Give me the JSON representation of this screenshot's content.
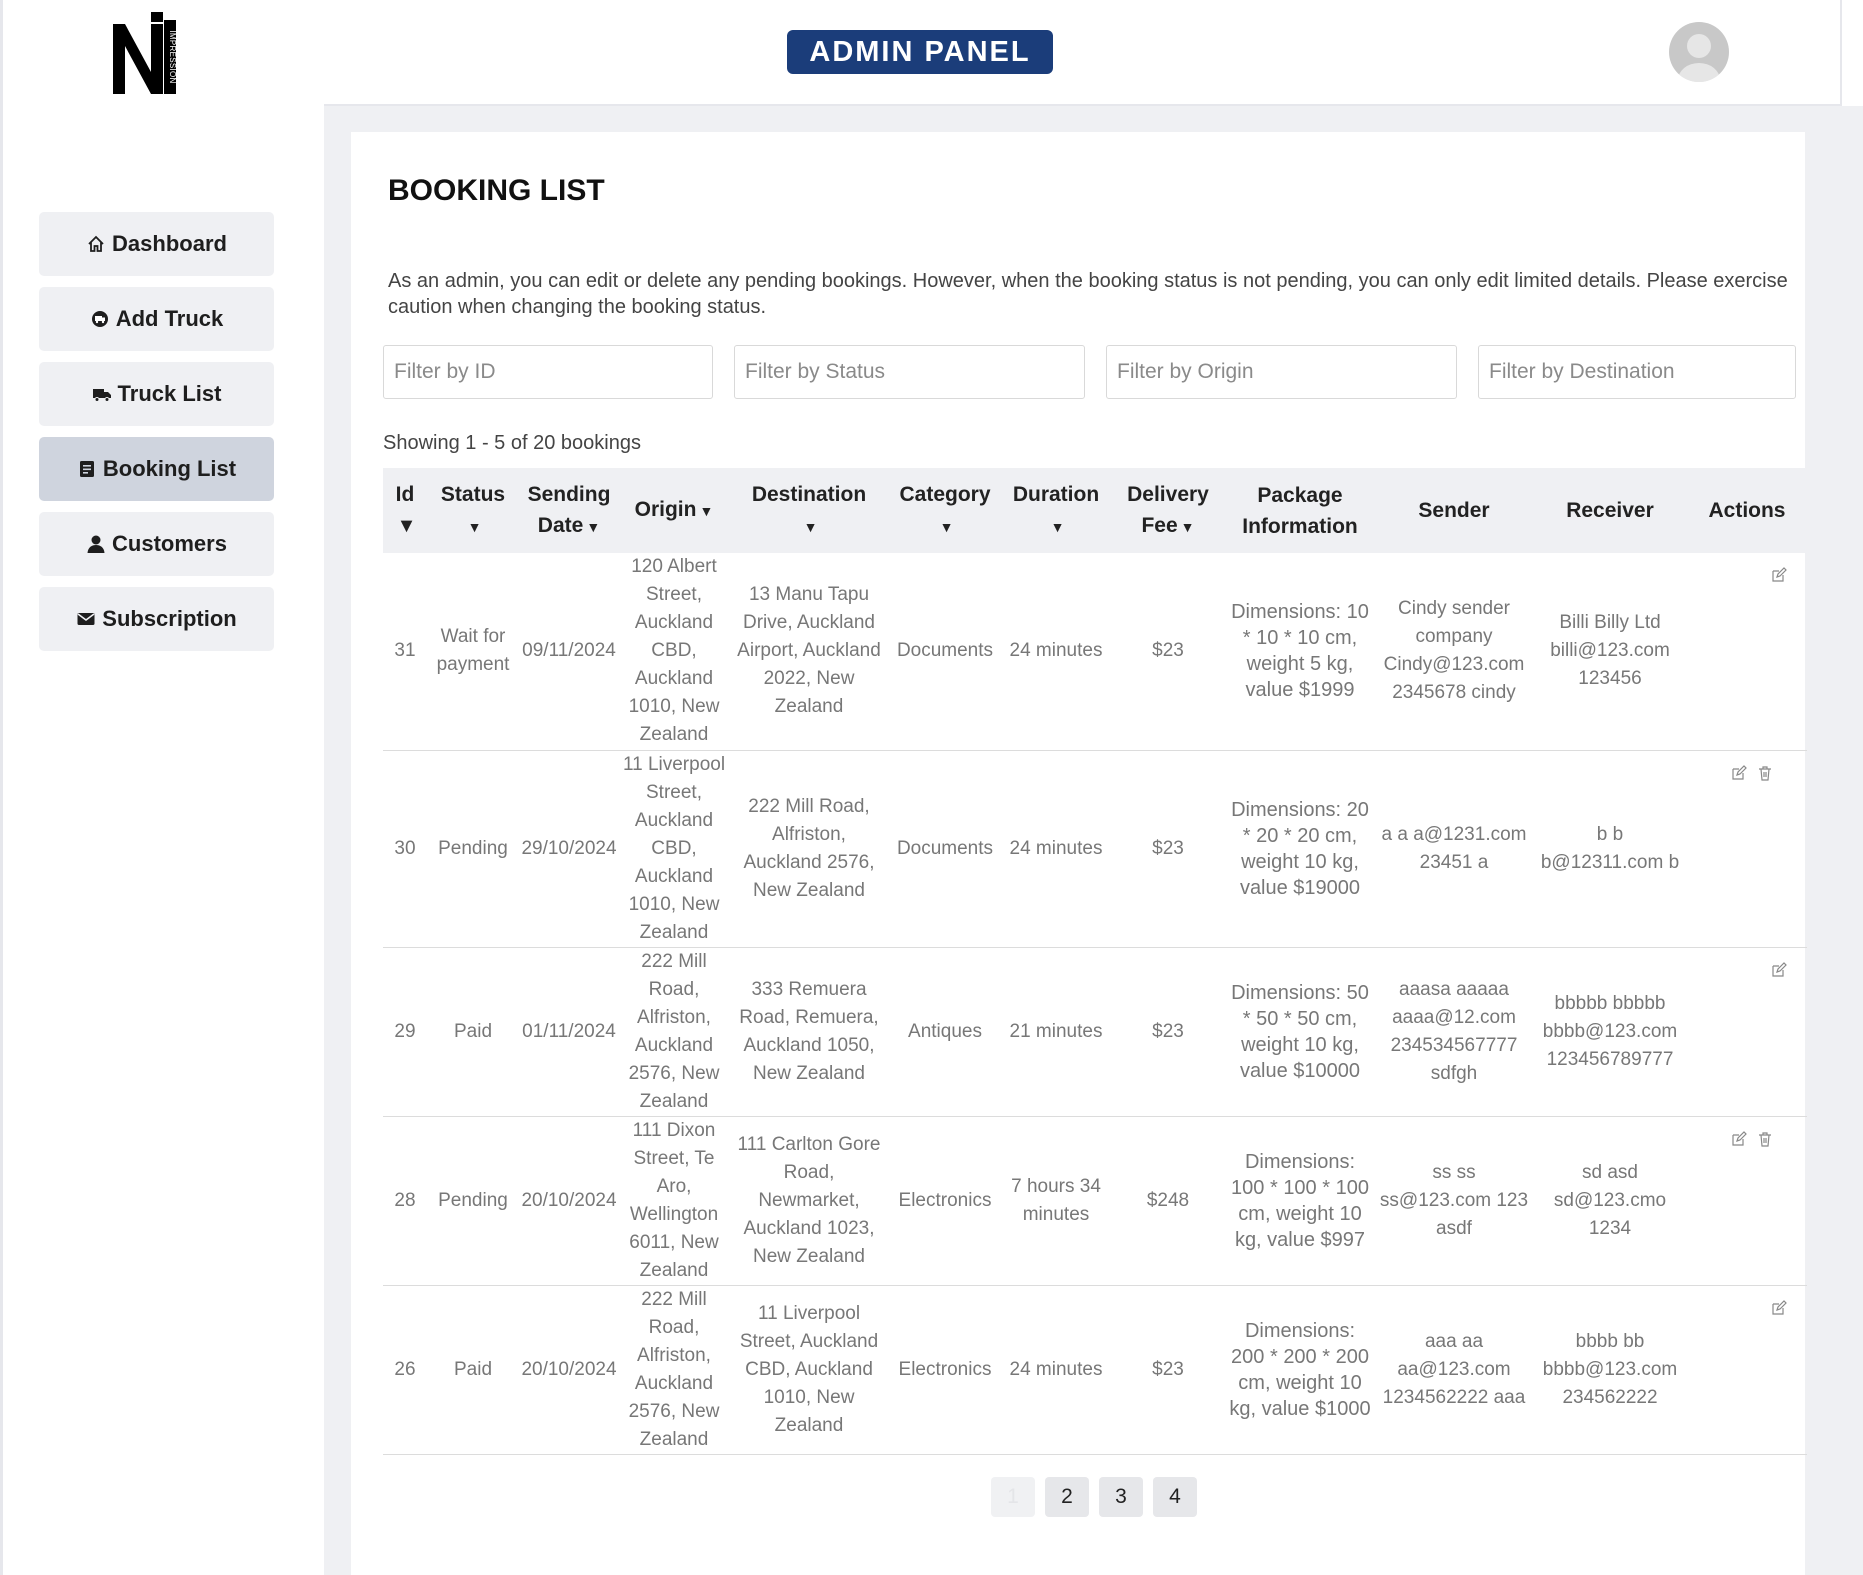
{
  "logo": {
    "letter": "N",
    "text": "IMPRESSION"
  },
  "header": {
    "badge": "ADMIN PANEL",
    "avatar_icon": "user-avatar-icon"
  },
  "sidebar": {
    "items": [
      {
        "label": "Dashboard",
        "icon": "home-icon"
      },
      {
        "label": "Add Truck",
        "icon": "truck-add-icon"
      },
      {
        "label": "Truck List",
        "icon": "truck-icon"
      },
      {
        "label": "Booking List",
        "icon": "book-icon",
        "active": true
      },
      {
        "label": "Customers",
        "icon": "user-icon"
      },
      {
        "label": "Subscription",
        "icon": "envelope-icon"
      }
    ]
  },
  "page": {
    "title": "BOOKING LIST",
    "notice": "As an admin, you can edit or delete any pending bookings. However, when the booking status is not pending, you can only edit limited details. Please exercise caution when changing the booking status.",
    "showing": "Showing 1 - 5 of 20 bookings"
  },
  "filters": {
    "id_placeholder": "Filter by ID",
    "status_placeholder": "Filter by Status",
    "origin_placeholder": "Filter by Origin",
    "destination_placeholder": "Filter by Destination"
  },
  "table": {
    "headers": {
      "id": "Id",
      "status": "Status",
      "sending_date": "Sending Date",
      "origin": "Origin",
      "destination": "Destination",
      "category": "Category",
      "duration": "Duration",
      "delivery_fee": "Delivery Fee",
      "package": "Package Information",
      "sender": "Sender",
      "receiver": "Receiver",
      "actions": "Actions"
    },
    "rows": [
      {
        "id": "31",
        "status": "Wait for payment",
        "date": "09/11/2024",
        "origin": "120 Albert Street, Auckland CBD, Auckland 1010, New Zealand",
        "destination": "13 Manu Tapu Drive, Auckland Airport, Auckland 2022, New Zealand",
        "category": "Documents",
        "duration": "24 minutes",
        "fee": "$23",
        "package": "Dimensions: 10 * 10 * 10 cm, weight 5 kg, value $1999",
        "sender": "Cindy sender company Cindy@123.com 2345678 cindy",
        "receiver": "Billi Billy Ltd billi@123.com 123456",
        "deletable": false
      },
      {
        "id": "30",
        "status": "Pending",
        "date": "29/10/2024",
        "origin": "11 Liverpool Street, Auckland CBD, Auckland 1010, New Zealand",
        "destination": "222 Mill Road, Alfriston, Auckland 2576, New Zealand",
        "category": "Documents",
        "duration": "24 minutes",
        "fee": "$23",
        "package": "Dimensions: 20 * 20 * 20 cm, weight 10 kg, value $19000",
        "sender": "a a a@1231.com 23451 a",
        "receiver": "b b b@12311.com b",
        "deletable": true
      },
      {
        "id": "29",
        "status": "Paid",
        "date": "01/11/2024",
        "origin": "222 Mill Road, Alfriston, Auckland 2576, New Zealand",
        "destination": "333 Remuera Road, Remuera, Auckland 1050, New Zealand",
        "category": "Antiques",
        "duration": "21 minutes",
        "fee": "$23",
        "package": "Dimensions: 50 * 50 * 50 cm, weight 10 kg, value $10000",
        "sender": "aaasa aaaaa aaaa@12.com 234534567777 sdfgh",
        "receiver": "bbbbb bbbbb bbbb@123.com 123456789777",
        "deletable": false
      },
      {
        "id": "28",
        "status": "Pending",
        "date": "20/10/2024",
        "origin": "111 Dixon Street, Te Aro, Wellington 6011, New Zealand",
        "destination": "111 Carlton Gore Road, Newmarket, Auckland 1023, New Zealand",
        "category": "Electronics",
        "duration": "7 hours 34 minutes",
        "fee": "$248",
        "package": "Dimensions: 100 * 100 * 100 cm, weight 10 kg, value $997",
        "sender": "ss ss ss@123.com 123 asdf",
        "receiver": "sd asd sd@123.cmo 1234",
        "deletable": true
      },
      {
        "id": "26",
        "status": "Paid",
        "date": "20/10/2024",
        "origin": "222 Mill Road, Alfriston, Auckland 2576, New Zealand",
        "destination": "11 Liverpool Street, Auckland CBD, Auckland 1010, New Zealand",
        "category": "Electronics",
        "duration": "24 minutes",
        "fee": "$23",
        "package": "Dimensions: 200 * 200 * 200 cm, weight 10 kg, value $1000",
        "sender": "aaa aa aa@123.com 1234562222 aaa",
        "receiver": "bbbb bb bbbb@123.com 234562222",
        "deletable": false
      }
    ]
  },
  "pagination": {
    "pages": [
      "1",
      "2",
      "3",
      "4"
    ],
    "current": "1"
  },
  "colors": {
    "badge": "#1b3d7a",
    "active_nav": "#cfd4de",
    "page_bg": "#eff0f3"
  }
}
